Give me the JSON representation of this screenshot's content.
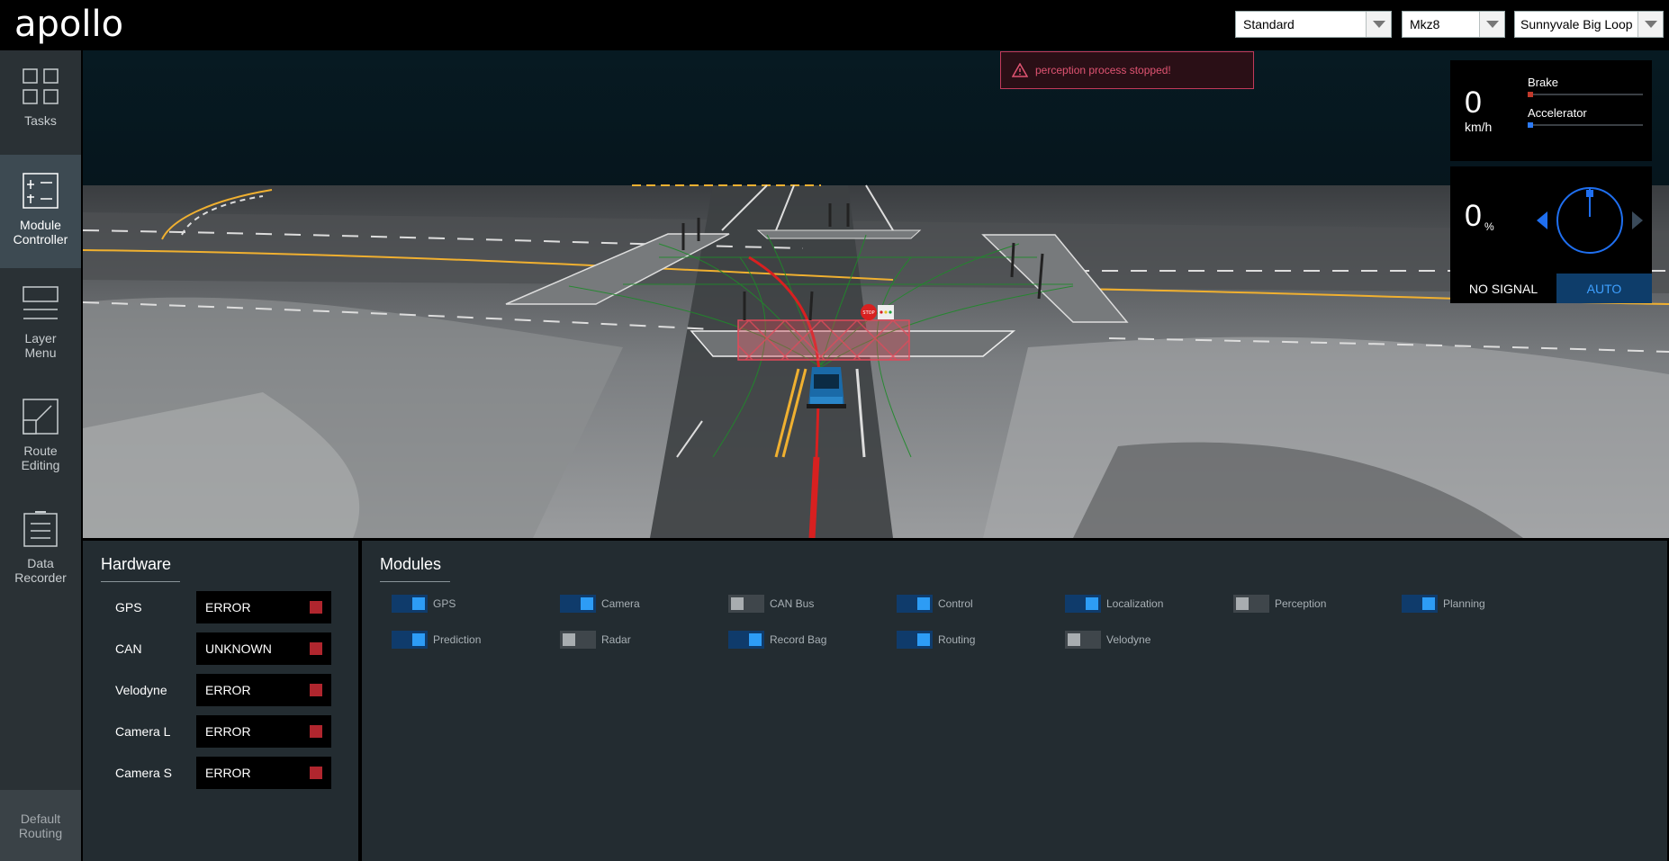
{
  "header": {
    "logo_text": "apollo",
    "dropdowns": [
      {
        "value": "Standard"
      },
      {
        "value": "Mkz8"
      },
      {
        "value": "Sunnyvale Big Loop"
      }
    ]
  },
  "sidebar": {
    "items": [
      {
        "label_1": "Tasks",
        "label_2": ""
      },
      {
        "label_1": "Module",
        "label_2": "Controller"
      },
      {
        "label_1": "Layer",
        "label_2": "Menu"
      },
      {
        "label_1": "Route",
        "label_2": "Editing"
      },
      {
        "label_1": "Data",
        "label_2": "Recorder"
      }
    ],
    "default_routing_1": "Default",
    "default_routing_2": "Routing"
  },
  "alert": {
    "message": "perception process stopped!"
  },
  "dashboard": {
    "speed": "0",
    "speed_unit": "km/h",
    "brake_label": "Brake",
    "accelerator_label": "Accelerator",
    "brake_level": 0,
    "accelerator_level": 0,
    "steering_value": "0",
    "steering_unit": "%",
    "signal_text": "NO SIGNAL",
    "drive_mode": "AUTO"
  },
  "hardware": {
    "title": "Hardware",
    "rows": [
      {
        "name": "GPS",
        "status": "ERROR"
      },
      {
        "name": "CAN",
        "status": "UNKNOWN"
      },
      {
        "name": "Velodyne",
        "status": "ERROR"
      },
      {
        "name": "Camera L",
        "status": "ERROR"
      },
      {
        "name": "Camera S",
        "status": "ERROR"
      }
    ]
  },
  "modules": {
    "title": "Modules",
    "items": [
      {
        "name": "GPS",
        "on": true
      },
      {
        "name": "Camera",
        "on": true
      },
      {
        "name": "CAN Bus",
        "on": false
      },
      {
        "name": "Control",
        "on": true
      },
      {
        "name": "Localization",
        "on": true
      },
      {
        "name": "Perception",
        "on": false
      },
      {
        "name": "Planning",
        "on": true
      },
      {
        "name": "Prediction",
        "on": true
      },
      {
        "name": "Radar",
        "on": false
      },
      {
        "name": "Record Bag",
        "on": true
      },
      {
        "name": "Routing",
        "on": true
      },
      {
        "name": "Velodyne",
        "on": false
      }
    ]
  },
  "scene": {
    "stop_sign_text": "STOP"
  },
  "colors": {
    "accent": "#2d9cf5",
    "error": "#b0262e",
    "alert": "#e05472",
    "panel": "#232c31",
    "sidebar": "#2a3135"
  }
}
